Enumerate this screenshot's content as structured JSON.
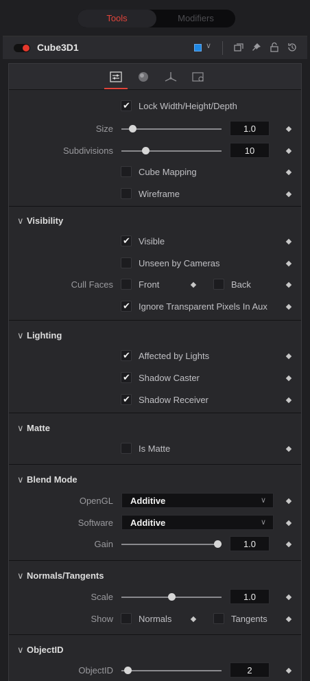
{
  "tabs": {
    "tools": "Tools",
    "modifiers": "Modifiers"
  },
  "node": {
    "name": "Cube3D1",
    "color": "#1e88e5"
  },
  "colors": {
    "accent": "#e1443a"
  },
  "icons": [
    "controls-icon",
    "material-icon",
    "transform-icon",
    "settings-icon"
  ],
  "controls": {
    "lock_label": "Lock Width/Height/Depth",
    "lock_checked": true,
    "size_label": "Size",
    "size_value": "1.0",
    "subdivisions_label": "Subdivisions",
    "subdivisions_value": "10",
    "cube_mapping_label": "Cube Mapping",
    "cube_mapping_checked": false,
    "wireframe_label": "Wireframe",
    "wireframe_checked": false
  },
  "visibility": {
    "title": "Visibility",
    "visible_label": "Visible",
    "visible_checked": true,
    "unseen_label": "Unseen by Cameras",
    "unseen_checked": false,
    "cull_label": "Cull Faces",
    "front_label": "Front",
    "back_label": "Back",
    "ignore_label": "Ignore Transparent Pixels In Aux",
    "ignore_checked": true
  },
  "lighting": {
    "title": "Lighting",
    "affected_label": "Affected by Lights",
    "caster_label": "Shadow Caster",
    "receiver_label": "Shadow Receiver"
  },
  "matte": {
    "title": "Matte",
    "is_matte_label": "Is Matte"
  },
  "blend": {
    "title": "Blend Mode",
    "opengl_label": "OpenGL",
    "opengl_value": "Additive",
    "software_label": "Software",
    "software_value": "Additive",
    "gain_label": "Gain",
    "gain_value": "1.0"
  },
  "normals": {
    "title": "Normals/Tangents",
    "scale_label": "Scale",
    "scale_value": "1.0",
    "show_label": "Show",
    "normals_label": "Normals",
    "tangents_label": "Tangents"
  },
  "objectid": {
    "title": "ObjectID",
    "label": "ObjectID",
    "value": "2"
  }
}
